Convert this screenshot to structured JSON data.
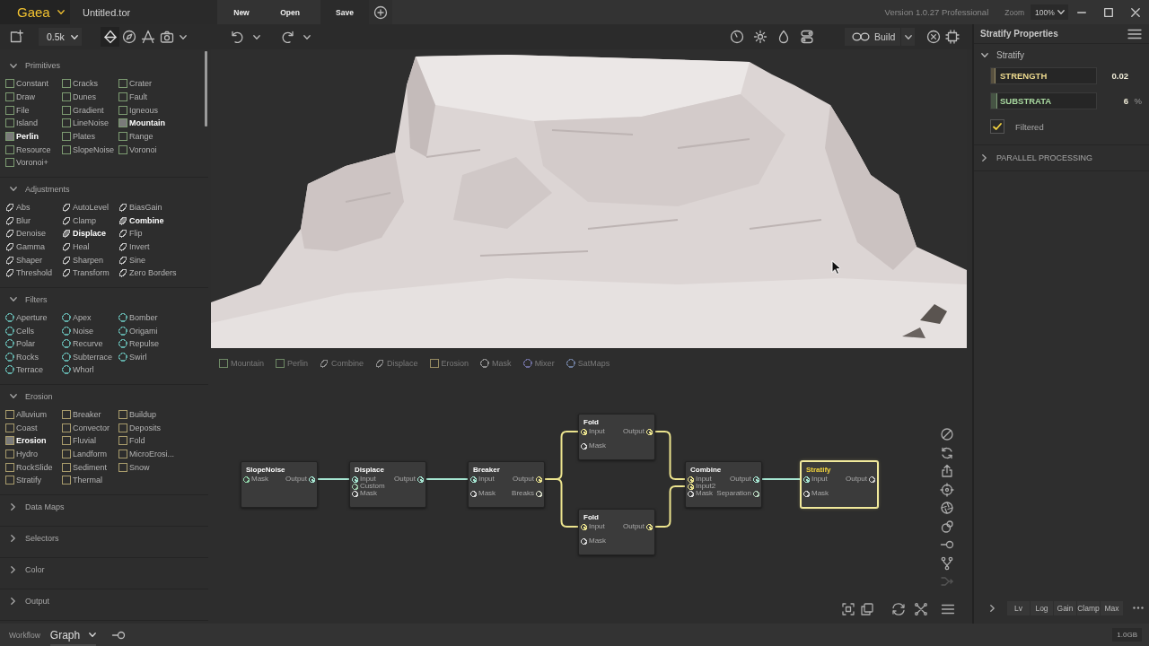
{
  "title_bar": {
    "logo": "Gaea",
    "file_name": "Untitled.tor",
    "menu": [
      {
        "label": "New",
        "kind": "plain"
      },
      {
        "label": "Open",
        "kind": "plain"
      },
      {
        "label": "Save",
        "kind": "boxed"
      }
    ],
    "version": "Version 1.0.27 Professional",
    "zoom_label": "Zoom",
    "zoom": "100%"
  },
  "toolbar": {
    "resolution": "0.5k",
    "view_tools": [
      {
        "selected": true
      },
      {
        "selected": false
      },
      {
        "selected": false
      },
      {
        "selected": false
      }
    ],
    "build": "Build"
  },
  "sidebar": {
    "sections": [
      {
        "title": "Primitives",
        "expanded": true,
        "kind": "square",
        "color": "#7d9c72",
        "items": [
          {
            "label": "Constant",
            "highlighted": false
          },
          {
            "label": "Cracks",
            "highlighted": false
          },
          {
            "label": "Crater",
            "highlighted": false
          },
          {
            "label": "Draw",
            "highlighted": false
          },
          {
            "label": "Dunes",
            "highlighted": false
          },
          {
            "label": "Fault",
            "highlighted": false
          },
          {
            "label": "File",
            "highlighted": false
          },
          {
            "label": "Gradient",
            "highlighted": false
          },
          {
            "label": "Igneous",
            "highlighted": false
          },
          {
            "label": "Island",
            "highlighted": false
          },
          {
            "label": "LineNoise",
            "highlighted": false
          },
          {
            "label": "Mountain",
            "highlighted": true
          },
          {
            "label": "Perlin",
            "highlighted": true
          },
          {
            "label": "Plates",
            "highlighted": false
          },
          {
            "label": "Range",
            "highlighted": false
          },
          {
            "label": "Resource",
            "highlighted": false
          },
          {
            "label": "SlopeNoise",
            "highlighted": false
          },
          {
            "label": "Voronoi",
            "highlighted": false
          },
          {
            "label": "Voronoi+",
            "highlighted": false
          }
        ]
      },
      {
        "title": "Adjustments",
        "expanded": true,
        "kind": "leaf",
        "color": "#c4c4c4",
        "items": [
          {
            "label": "Abs",
            "highlighted": false
          },
          {
            "label": "AutoLevel",
            "highlighted": false
          },
          {
            "label": "BiasGain",
            "highlighted": false
          },
          {
            "label": "Blur",
            "highlighted": false
          },
          {
            "label": "Clamp",
            "highlighted": false
          },
          {
            "label": "Combine",
            "highlighted": true
          },
          {
            "label": "Denoise",
            "highlighted": false
          },
          {
            "label": "Displace",
            "highlighted": true
          },
          {
            "label": "Flip",
            "highlighted": false
          },
          {
            "label": "Gamma",
            "highlighted": false
          },
          {
            "label": "Heal",
            "highlighted": false
          },
          {
            "label": "Invert",
            "highlighted": false
          },
          {
            "label": "Shaper",
            "highlighted": false
          },
          {
            "label": "Sharpen",
            "highlighted": false
          },
          {
            "label": "Sine",
            "highlighted": false
          },
          {
            "label": "Threshold",
            "highlighted": false
          },
          {
            "label": "Transform",
            "highlighted": false
          },
          {
            "label": "Zero Borders",
            "highlighted": false
          }
        ]
      },
      {
        "title": "Filters",
        "expanded": true,
        "kind": "circle",
        "color": "#5fa9a3",
        "items": [
          {
            "label": "Aperture",
            "highlighted": false
          },
          {
            "label": "Apex",
            "highlighted": false
          },
          {
            "label": "Bomber",
            "highlighted": false
          },
          {
            "label": "Cells",
            "highlighted": false
          },
          {
            "label": "Noise",
            "highlighted": false
          },
          {
            "label": "Origami",
            "highlighted": false
          },
          {
            "label": "Polar",
            "highlighted": false
          },
          {
            "label": "Recurve",
            "highlighted": false
          },
          {
            "label": "Repulse",
            "highlighted": false
          },
          {
            "label": "Rocks",
            "highlighted": false
          },
          {
            "label": "Subterrace",
            "highlighted": false
          },
          {
            "label": "Swirl",
            "highlighted": false
          },
          {
            "label": "Terrace",
            "highlighted": false
          },
          {
            "label": "Whorl",
            "highlighted": false
          }
        ]
      },
      {
        "title": "Erosion",
        "expanded": true,
        "kind": "square",
        "color": "#a99c6c",
        "items": [
          {
            "label": "Alluvium",
            "highlighted": false
          },
          {
            "label": "Breaker",
            "highlighted": false
          },
          {
            "label": "Buildup",
            "highlighted": false
          },
          {
            "label": "Coast",
            "highlighted": false
          },
          {
            "label": "Convector",
            "highlighted": false
          },
          {
            "label": "Deposits",
            "highlighted": false
          },
          {
            "label": "Erosion",
            "highlighted": true
          },
          {
            "label": "Fluvial",
            "highlighted": false
          },
          {
            "label": "Fold",
            "highlighted": false
          },
          {
            "label": "Hydro",
            "highlighted": false
          },
          {
            "label": "Landform",
            "highlighted": false
          },
          {
            "label": "MicroErosi...",
            "highlighted": false
          },
          {
            "label": "RockSlide",
            "highlighted": false
          },
          {
            "label": "Sediment",
            "highlighted": false
          },
          {
            "label": "Snow",
            "highlighted": false
          },
          {
            "label": "Stratify",
            "highlighted": false
          },
          {
            "label": "Thermal",
            "highlighted": false
          }
        ]
      },
      {
        "title": "Data Maps",
        "expanded": false
      },
      {
        "title": "Selectors",
        "expanded": false
      },
      {
        "title": "Color",
        "expanded": false
      },
      {
        "title": "Output",
        "expanded": false
      }
    ]
  },
  "recent_nodes": [
    {
      "label": "Mountain",
      "kind": "square",
      "color": "#6f8a66"
    },
    {
      "label": "Perlin",
      "kind": "square",
      "color": "#6f8a66"
    },
    {
      "label": "Combine",
      "kind": "leaf",
      "color": "#8c8c8c"
    },
    {
      "label": "Displace",
      "kind": "leaf",
      "color": "#8c8c8c"
    },
    {
      "label": "Erosion",
      "kind": "square",
      "color": "#968b62"
    },
    {
      "label": "Mask",
      "kind": "circle",
      "color": "#8a8a8a"
    },
    {
      "label": "Mixer",
      "kind": "circle",
      "color": "#6a6a96"
    },
    {
      "label": "SatMaps",
      "kind": "circle",
      "color": "#6a7896"
    }
  ],
  "graph": {
    "nodes": [
      {
        "title": "SlopeNoise",
        "selected": false,
        "inputs": [
          {
            "label": "Mask",
            "connected": false,
            "color": "#8fd4a8"
          }
        ],
        "outputs": [
          {
            "label": "Output",
            "connected": true,
            "color": "#a6e6d2"
          }
        ]
      },
      {
        "title": "Displace",
        "selected": false,
        "inputs": [
          {
            "label": "Input",
            "connected": true,
            "color": "#a6e6d2"
          },
          {
            "label": "Custom",
            "connected": false,
            "color": "#9cc8a8"
          },
          {
            "label": "Mask",
            "connected": false,
            "color": "#d8d8d8"
          }
        ],
        "outputs": [
          {
            "label": "Output",
            "connected": true,
            "color": "#a6e6d2"
          }
        ]
      },
      {
        "title": "Breaker",
        "selected": false,
        "inputs": [
          {
            "label": "Input",
            "connected": true,
            "color": "#a6e6d2"
          },
          {
            "label": "Mask",
            "connected": false,
            "color": "#d8d8d8"
          }
        ],
        "outputs": [
          {
            "label": "Output",
            "connected": true,
            "color": "#ece48e"
          },
          {
            "label": "Breaks",
            "connected": false,
            "color": "#d8dcc8"
          }
        ]
      },
      {
        "title": "Fold",
        "selected": false,
        "inputs": [
          {
            "label": "Input",
            "connected": true,
            "color": "#ece48e"
          },
          {
            "label": "Mask",
            "connected": false,
            "color": "#d8d8d8"
          }
        ],
        "outputs": [
          {
            "label": "Output",
            "connected": true,
            "color": "#ece48e"
          }
        ]
      },
      {
        "title": "Fold",
        "selected": false,
        "inputs": [
          {
            "label": "Input",
            "connected": true,
            "color": "#ece48e"
          },
          {
            "label": "Mask",
            "connected": false,
            "color": "#d8d8d8"
          }
        ],
        "outputs": [
          {
            "label": "Output",
            "connected": true,
            "color": "#ece48e"
          }
        ]
      },
      {
        "title": "Combine",
        "selected": false,
        "inputs": [
          {
            "label": "Input",
            "connected": true,
            "color": "#ece48e"
          },
          {
            "label": "Input2",
            "connected": true,
            "color": "#ece48e"
          },
          {
            "label": "Mask",
            "connected": false,
            "color": "#d8d8d8"
          }
        ],
        "outputs": [
          {
            "label": "Output",
            "connected": true,
            "color": "#a6e6d2"
          },
          {
            "label": "Separation",
            "connected": false,
            "color": "#b8d8c0"
          }
        ]
      },
      {
        "title": "Stratify",
        "selected": true,
        "inputs": [
          {
            "label": "Input",
            "connected": true,
            "color": "#a6e6d2"
          },
          {
            "label": "Mask",
            "connected": false,
            "color": "#d8d8d8"
          }
        ],
        "outputs": [
          {
            "label": "Output",
            "connected": false,
            "color": "#c8c8c8"
          }
        ]
      }
    ]
  },
  "properties": {
    "title": "Stratify Properties",
    "sections": [
      {
        "title": "Stratify",
        "expanded": true,
        "params": [
          {
            "kind": "slider",
            "label": "STRENGTH",
            "value": "0.02",
            "level": 0.04,
            "color": "#ecd98e"
          },
          {
            "kind": "slider",
            "label": "SUBSTRATA",
            "value": "6",
            "unit": "%",
            "level": 0.06,
            "color": "#a9d9a0"
          },
          {
            "kind": "checkbox",
            "label": "Filtered",
            "checked": true
          }
        ]
      },
      {
        "title": "PARALLEL PROCESSING",
        "expanded": false
      }
    ],
    "display_modes": [
      "Lv",
      "Log",
      "Gain",
      "Clamp",
      "Max"
    ]
  },
  "status_bar": {
    "workflow_label": "Workflow",
    "workflow": "Graph",
    "memory": "1.0GB"
  }
}
